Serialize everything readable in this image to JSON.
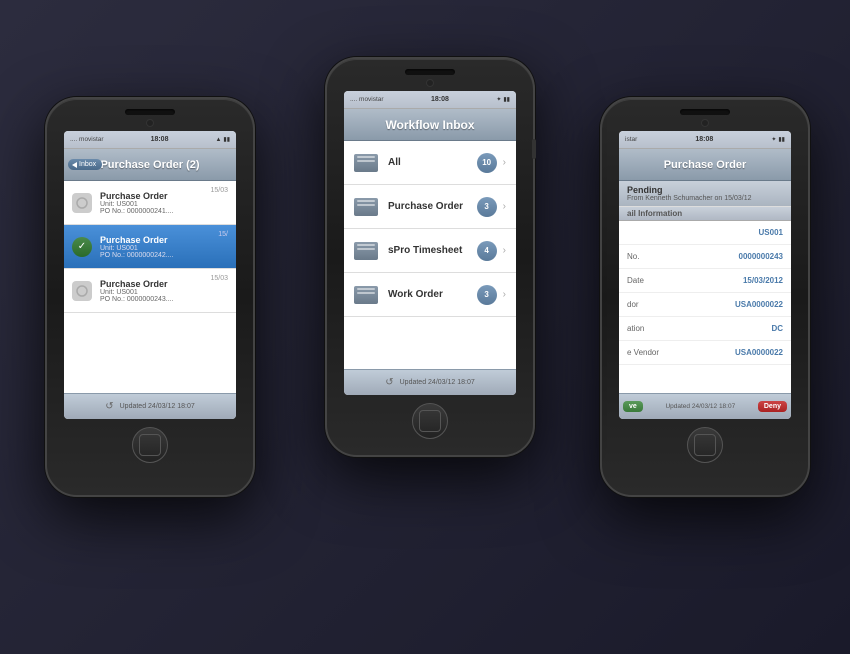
{
  "phones": {
    "left": {
      "carrier": ".... movistar",
      "time": "18:08",
      "nav_title": "Purchase Order (2)",
      "back_label": "Inbox",
      "items": [
        {
          "id": "po1",
          "title": "Purchase Order",
          "subtitle1": "Unit: US001",
          "subtitle2": "PO No.: 0000000241....",
          "date": "15/03",
          "selected": false,
          "checked": false
        },
        {
          "id": "po2",
          "title": "Purchase Order",
          "subtitle1": "Unit: US001",
          "subtitle2": "PO No.: 0000000242....",
          "date": "15/",
          "selected": true,
          "checked": true
        },
        {
          "id": "po3",
          "title": "Purchase Order",
          "subtitle1": "Unit: US001",
          "subtitle2": "PO No.: 0000000243....",
          "date": "15/03",
          "selected": false,
          "checked": false
        }
      ],
      "footer": "Updated 24/03/12 18:07"
    },
    "center": {
      "carrier": ".... movistar",
      "time": "18:08",
      "nav_title": "Workflow Inbox",
      "items": [
        {
          "label": "All",
          "count": "10"
        },
        {
          "label": "Purchase Order",
          "count": "3"
        },
        {
          "label": "sPro Timesheet",
          "count": "4"
        },
        {
          "label": "Work Order",
          "count": "3"
        }
      ],
      "footer": "Updated 24/03/12 18:07"
    },
    "right": {
      "carrier": "istar",
      "time": "18:08",
      "nav_title": "Purchase Order",
      "status_title": "Pending",
      "status_sub": "From Kenneth Schumacher on 15/03/12",
      "section_header": "ail Information",
      "rows": [
        {
          "label": "",
          "value": "US001"
        },
        {
          "label": "No.",
          "value": "0000000243"
        },
        {
          "label": "Date",
          "value": "15/03/2012"
        },
        {
          "label": "dor",
          "value": "USA0000022"
        },
        {
          "label": "ation",
          "value": "DC"
        },
        {
          "label": "e Vendor",
          "value": "USA0000022"
        }
      ],
      "footer": "Updated 24/03/12 18:07",
      "approve_label": "ve",
      "deny_label": "Deny"
    }
  }
}
